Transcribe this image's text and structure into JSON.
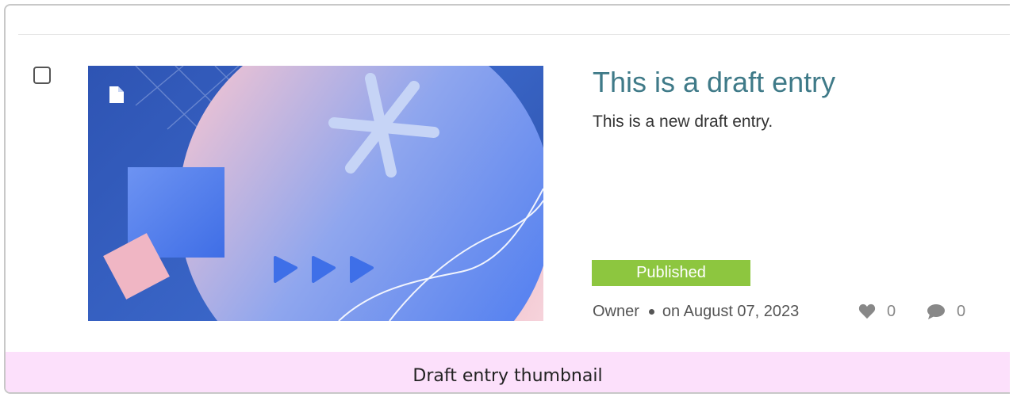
{
  "entry": {
    "title": "This is a draft entry",
    "excerpt": "This is a new draft entry.",
    "status": "Published",
    "status_color": "#8dc63f",
    "author": "Owner",
    "date": "on August 07, 2023",
    "likes": "0",
    "comments": "0",
    "thumbnail_icon": "document-icon"
  },
  "caption": "Draft entry thumbnail"
}
